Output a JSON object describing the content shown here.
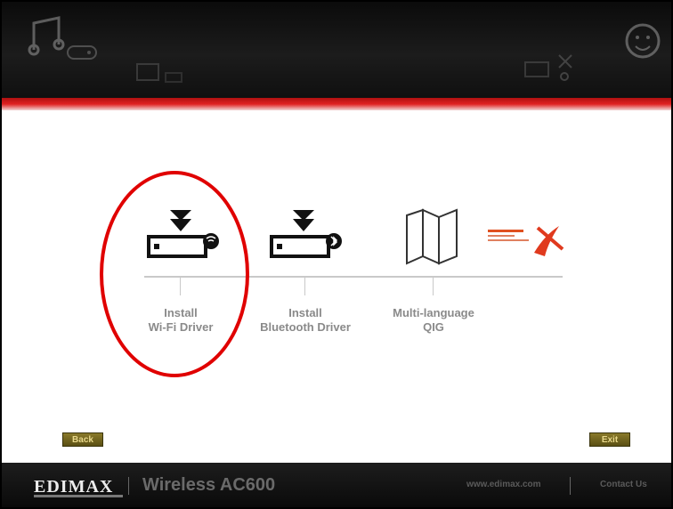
{
  "app": {
    "brand": "EDIMAX",
    "product": "Wireless AC600"
  },
  "header": {
    "decorative_icons": [
      "music-note-icon",
      "gamepad-icon",
      "folder-icon",
      "tools-icon",
      "smiley-icon"
    ]
  },
  "menu": {
    "items": [
      {
        "label": "Install\nWi-Fi Driver",
        "icon": "wifi-driver-download-icon",
        "highlighted": true
      },
      {
        "label": "Install\nBluetooth Driver",
        "icon": "bluetooth-driver-download-icon",
        "highlighted": false
      },
      {
        "label": "Multi-language\nQIG",
        "icon": "folded-map-icon",
        "highlighted": false
      },
      {
        "label": "",
        "icon": "adobe-reader-icon",
        "highlighted": false
      }
    ]
  },
  "buttons": {
    "back_label": "Back",
    "exit_label": "Exit"
  },
  "footer": {
    "website": "www.edimax.com",
    "contact_label": "Contact Us"
  },
  "colors": {
    "accent_red": "#e02222",
    "highlight_circle": "#e00000",
    "button": "#6e6220",
    "background": "#ffffff"
  }
}
